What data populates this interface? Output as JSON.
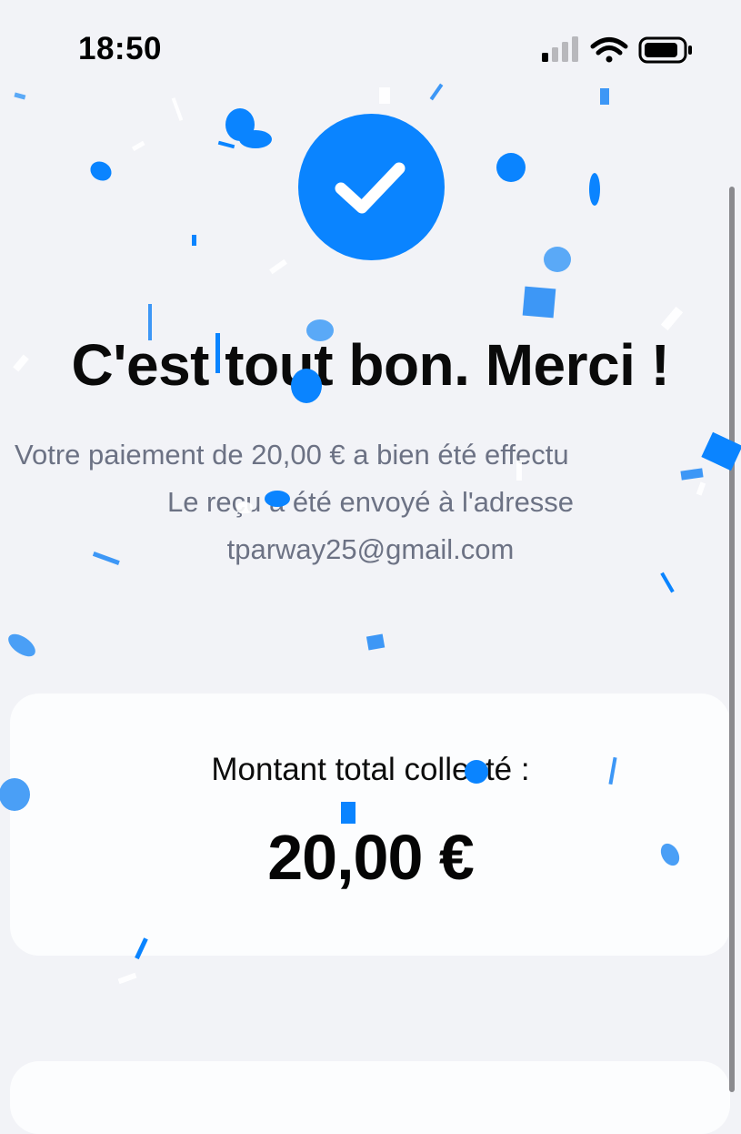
{
  "status_bar": {
    "time": "18:50",
    "icons": [
      "cellular-signal-icon",
      "wifi-icon",
      "battery-icon"
    ]
  },
  "success": {
    "icon": "checkmark-icon",
    "headline": "C'est tout bon. Merci !",
    "message_line_1": "Votre paiement de 20,00 € a bien été effectu",
    "message_line_2": "Le reçu a été envoyé à l'adresse",
    "email": "tparway25@gmail.com"
  },
  "total_card": {
    "label": "Montant total collecté :",
    "amount": "20,00 €"
  },
  "colors": {
    "accent": "#0a84ff",
    "background": "#f2f3f7",
    "card": "#fcfdfe",
    "muted_text": "#6c7284"
  }
}
